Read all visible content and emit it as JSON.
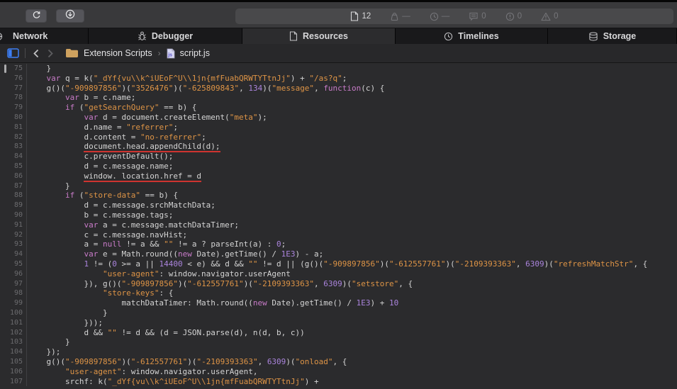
{
  "toolbar": {
    "activity": {
      "items": [
        {
          "icon": "document",
          "value": "12",
          "dim": false,
          "name": "resource-count"
        },
        {
          "icon": "weight",
          "value": "—",
          "dim": true,
          "name": "resource-size"
        },
        {
          "icon": "clock",
          "value": "—",
          "dim": true,
          "name": "load-time"
        },
        {
          "icon": "bubble",
          "value": "0",
          "dim": true,
          "name": "console-message-count"
        },
        {
          "icon": "circle-exclaim",
          "value": "0",
          "dim": true,
          "name": "error-count"
        },
        {
          "icon": "triangle-exclaim",
          "value": "0",
          "dim": true,
          "name": "warning-count"
        }
      ]
    }
  },
  "tabs": [
    {
      "id": "network",
      "label": "Network",
      "icon": "globe",
      "selected": false
    },
    {
      "id": "debugger",
      "label": "Debugger",
      "icon": "bug",
      "selected": false
    },
    {
      "id": "resources",
      "label": "Resources",
      "icon": "document",
      "selected": true
    },
    {
      "id": "timelines",
      "label": "Timelines",
      "icon": "clock",
      "selected": false
    },
    {
      "id": "storage",
      "label": "Storage",
      "icon": "database",
      "selected": false
    }
  ],
  "breadcrumb": {
    "folder": "Extension Scripts",
    "separator": "›",
    "file": "script.js"
  },
  "editor": {
    "lines": [
      {
        "n": 75,
        "i": 4,
        "s": [
          [
            "p",
            "}"
          ]
        ]
      },
      {
        "n": 76,
        "i": 4,
        "s": [
          [
            "k",
            "var"
          ],
          [
            "p",
            " q = k("
          ],
          [
            "s",
            "\"_dYf{vu\\\\k^iUEoF^U\\\\1jn{mfFuabQRWTYTtnJj\""
          ],
          [
            "p",
            ") + "
          ],
          [
            "s",
            "\"/as?q\""
          ],
          [
            "p",
            ";"
          ]
        ]
      },
      {
        "n": 77,
        "i": 4,
        "s": [
          [
            "p",
            "g()("
          ],
          [
            "s",
            "\"-909897856\""
          ],
          [
            "p",
            ")("
          ],
          [
            "s",
            "\"3526476\""
          ],
          [
            "p",
            ")("
          ],
          [
            "s",
            "\"-625809843\""
          ],
          [
            "p",
            ", "
          ],
          [
            "n",
            "134"
          ],
          [
            "p",
            ")("
          ],
          [
            "s",
            "\"message\""
          ],
          [
            "p",
            ", "
          ],
          [
            "k",
            "function"
          ],
          [
            "p",
            "(c) {"
          ]
        ]
      },
      {
        "n": 78,
        "i": 8,
        "s": [
          [
            "k",
            "var"
          ],
          [
            "p",
            " b = c.name;"
          ]
        ]
      },
      {
        "n": 79,
        "i": 8,
        "s": [
          [
            "k",
            "if"
          ],
          [
            "p",
            " ("
          ],
          [
            "s",
            "\"getSearchQuery\""
          ],
          [
            "p",
            " == b) {"
          ]
        ]
      },
      {
        "n": 80,
        "i": 12,
        "s": [
          [
            "k",
            "var"
          ],
          [
            "p",
            " d = document.createElement("
          ],
          [
            "s",
            "\"meta\""
          ],
          [
            "p",
            ");"
          ]
        ]
      },
      {
        "n": 81,
        "i": 12,
        "s": [
          [
            "p",
            "d.name = "
          ],
          [
            "s",
            "\"referrer\""
          ],
          [
            "p",
            ";"
          ]
        ]
      },
      {
        "n": 82,
        "i": 12,
        "s": [
          [
            "p",
            "d.content = "
          ],
          [
            "s",
            "\"no-referrer\""
          ],
          [
            "p",
            ";"
          ]
        ]
      },
      {
        "n": 83,
        "i": 12,
        "u": true,
        "s": [
          [
            "p",
            "document.head.appendChild(d);"
          ]
        ]
      },
      {
        "n": 84,
        "i": 12,
        "s": [
          [
            "p",
            "c.preventDefault();"
          ]
        ]
      },
      {
        "n": 85,
        "i": 12,
        "s": [
          [
            "p",
            "d = c.message.name;"
          ]
        ]
      },
      {
        "n": 86,
        "i": 12,
        "u": true,
        "s": [
          [
            "p",
            "window. location.href = d"
          ]
        ]
      },
      {
        "n": 87,
        "i": 8,
        "s": [
          [
            "p",
            "}"
          ]
        ]
      },
      {
        "n": 88,
        "i": 8,
        "s": [
          [
            "k",
            "if"
          ],
          [
            "p",
            " ("
          ],
          [
            "s",
            "\"store-data\""
          ],
          [
            "p",
            " == b) {"
          ]
        ]
      },
      {
        "n": 89,
        "i": 12,
        "s": [
          [
            "p",
            "d = c.message.srchMatchData;"
          ]
        ]
      },
      {
        "n": 90,
        "i": 12,
        "s": [
          [
            "p",
            "b = c.message.tags;"
          ]
        ]
      },
      {
        "n": 91,
        "i": 12,
        "s": [
          [
            "k",
            "var"
          ],
          [
            "p",
            " a = c.message.matchDataTimer;"
          ]
        ]
      },
      {
        "n": 92,
        "i": 12,
        "s": [
          [
            "p",
            "c = c.message.navHist;"
          ]
        ]
      },
      {
        "n": 93,
        "i": 12,
        "s": [
          [
            "p",
            "a = "
          ],
          [
            "k",
            "null"
          ],
          [
            "p",
            " != a && "
          ],
          [
            "s",
            "\"\""
          ],
          [
            "p",
            " != a ? parseInt(a) : "
          ],
          [
            "n",
            "0"
          ],
          [
            "p",
            ";"
          ]
        ]
      },
      {
        "n": 94,
        "i": 12,
        "s": [
          [
            "k",
            "var"
          ],
          [
            "p",
            " e = Math.round(("
          ],
          [
            "k",
            "new"
          ],
          [
            "p",
            " Date).getTime() / "
          ],
          [
            "n",
            "1E3"
          ],
          [
            "p",
            ") - a;"
          ]
        ]
      },
      {
        "n": 95,
        "i": 12,
        "s": [
          [
            "n",
            "1"
          ],
          [
            "p",
            " != ("
          ],
          [
            "n",
            "0"
          ],
          [
            "p",
            " >= a || "
          ],
          [
            "n",
            "14400"
          ],
          [
            "p",
            " < e) && d && "
          ],
          [
            "s",
            "\"\""
          ],
          [
            "p",
            " != d || (g()("
          ],
          [
            "s",
            "\"-909897856\""
          ],
          [
            "p",
            ")("
          ],
          [
            "s",
            "\"-612557761\""
          ],
          [
            "p",
            ")("
          ],
          [
            "s",
            "\"-2109393363\""
          ],
          [
            "p",
            ", "
          ],
          [
            "n",
            "6309"
          ],
          [
            "p",
            ")("
          ],
          [
            "s",
            "\"refreshMatchStr\""
          ],
          [
            "p",
            ", {"
          ]
        ]
      },
      {
        "n": 96,
        "i": 16,
        "s": [
          [
            "s",
            "\"user-agent\""
          ],
          [
            "p",
            ": window.navigator.userAgent"
          ]
        ]
      },
      {
        "n": 97,
        "i": 12,
        "s": [
          [
            "p",
            "}), g()("
          ],
          [
            "s",
            "\"-909897856\""
          ],
          [
            "p",
            ")("
          ],
          [
            "s",
            "\"-612557761\""
          ],
          [
            "p",
            ")("
          ],
          [
            "s",
            "\"-2109393363\""
          ],
          [
            "p",
            ", "
          ],
          [
            "n",
            "6309"
          ],
          [
            "p",
            ")("
          ],
          [
            "s",
            "\"setstore\""
          ],
          [
            "p",
            ", {"
          ]
        ]
      },
      {
        "n": 98,
        "i": 16,
        "s": [
          [
            "s",
            "\"store-keys\""
          ],
          [
            "p",
            ": {"
          ]
        ]
      },
      {
        "n": 99,
        "i": 20,
        "s": [
          [
            "p",
            "matchDataTimer: Math.round(("
          ],
          [
            "k",
            "new"
          ],
          [
            "p",
            " Date).getTime() / "
          ],
          [
            "n",
            "1E3"
          ],
          [
            "p",
            ") + "
          ],
          [
            "n",
            "10"
          ]
        ]
      },
      {
        "n": 100,
        "i": 16,
        "s": [
          [
            "p",
            "}"
          ]
        ]
      },
      {
        "n": 101,
        "i": 12,
        "s": [
          [
            "p",
            "}));"
          ]
        ]
      },
      {
        "n": 102,
        "i": 12,
        "s": [
          [
            "p",
            "d && "
          ],
          [
            "s",
            "\"\""
          ],
          [
            "p",
            " != d && (d = JSON.parse(d), n(d, b, c))"
          ]
        ]
      },
      {
        "n": 103,
        "i": 8,
        "s": [
          [
            "p",
            "}"
          ]
        ]
      },
      {
        "n": 104,
        "i": 4,
        "s": [
          [
            "p",
            "});"
          ]
        ]
      },
      {
        "n": 105,
        "i": 4,
        "s": [
          [
            "p",
            "g()("
          ],
          [
            "s",
            "\"-909897856\""
          ],
          [
            "p",
            ")("
          ],
          [
            "s",
            "\"-612557761\""
          ],
          [
            "p",
            ")("
          ],
          [
            "s",
            "\"-2109393363\""
          ],
          [
            "p",
            ", "
          ],
          [
            "n",
            "6309"
          ],
          [
            "p",
            ")("
          ],
          [
            "s",
            "\"onload\""
          ],
          [
            "p",
            ", {"
          ]
        ]
      },
      {
        "n": 106,
        "i": 8,
        "s": [
          [
            "s",
            "\"user-agent\""
          ],
          [
            "p",
            ": window.navigator.userAgent,"
          ]
        ]
      },
      {
        "n": 107,
        "i": 8,
        "s": [
          [
            "p",
            "srchf: k("
          ],
          [
            "s",
            "\"_dYf{vu\\\\k^iUEoF^U\\\\1jn{mfFuabQRWTYTtnJj\""
          ],
          [
            "p",
            ") +"
          ]
        ]
      }
    ]
  },
  "colors": {
    "accent_blue": "#3d7ff5",
    "string_orange": "#de9446",
    "keyword_pink": "#c87bc8",
    "number_purple": "#ab84dd",
    "annotation_red": "#ce3430",
    "folder_tan": "#cfa25f"
  }
}
